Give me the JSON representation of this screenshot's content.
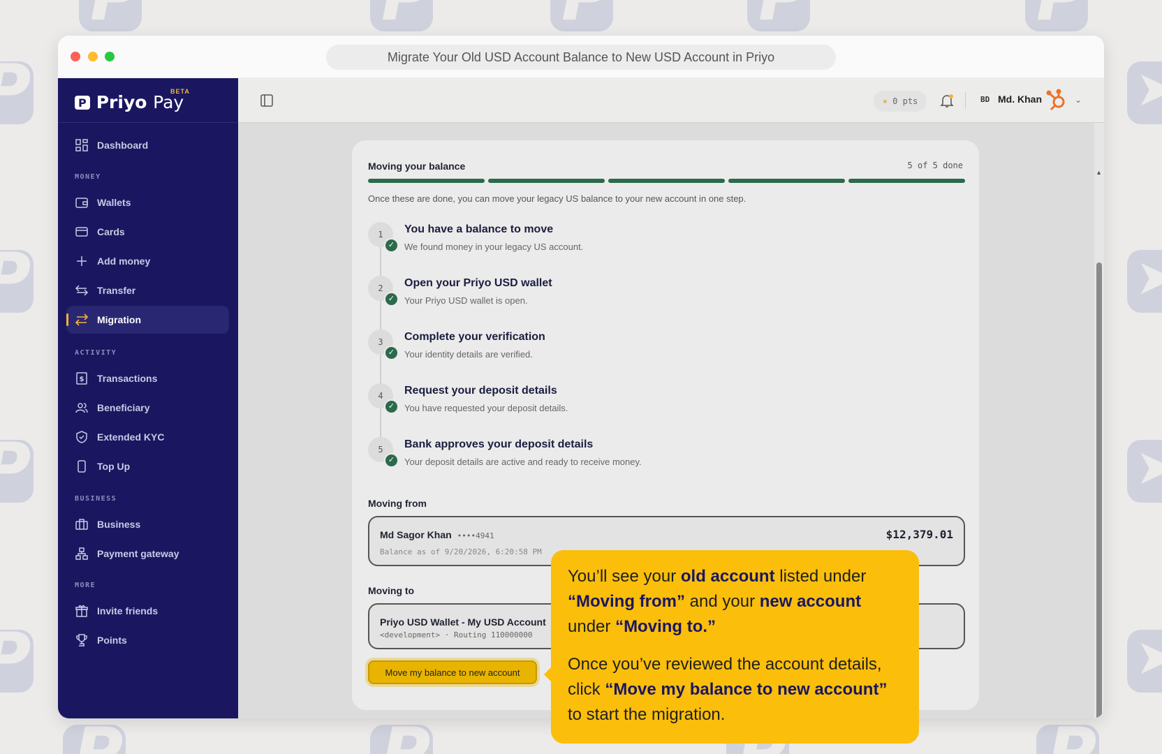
{
  "browser": {
    "url_title": "Migrate Your Old USD Account Balance to New USD Account in Priyo"
  },
  "sidebar": {
    "brand": "Priyo",
    "brand_suffix": "Pay",
    "badge": "BETA",
    "sections": {
      "money": "MONEY",
      "activity": "ACTIVITY",
      "business": "BUSINESS",
      "more": "MORE"
    },
    "items": [
      {
        "label": "Dashboard",
        "icon": "grid-icon"
      },
      {
        "label": "Wallets",
        "icon": "wallet-icon"
      },
      {
        "label": "Cards",
        "icon": "card-icon"
      },
      {
        "label": "Add money",
        "icon": "plus-icon"
      },
      {
        "label": "Transfer",
        "icon": "transfer-icon"
      },
      {
        "label": "Migration",
        "icon": "migration-icon",
        "active": true
      },
      {
        "label": "Transactions",
        "icon": "dollar-doc-icon"
      },
      {
        "label": "Beneficiary",
        "icon": "users-icon"
      },
      {
        "label": "Extended KYC",
        "icon": "shield-check-icon"
      },
      {
        "label": "Top Up",
        "icon": "phone-icon"
      },
      {
        "label": "Business",
        "icon": "briefcase-icon"
      },
      {
        "label": "Payment gateway",
        "icon": "network-icon"
      },
      {
        "label": "Invite friends",
        "icon": "gift-icon"
      },
      {
        "label": "Points",
        "icon": "trophy-icon"
      }
    ]
  },
  "topbar": {
    "points": "0 pts",
    "country": "BD",
    "user": "Md. Khan"
  },
  "card": {
    "title": "Moving your balance",
    "progress_text": "5 of 5 done",
    "progress": {
      "done": 5,
      "total": 5
    },
    "intro": "Once these are done, you can move your legacy US balance to your new account in one step.",
    "steps": [
      {
        "num": "1",
        "title": "You have a balance to move",
        "desc": "We found money in your legacy US account."
      },
      {
        "num": "2",
        "title": "Open your Priyo USD wallet",
        "desc": "Your Priyo USD wallet is open."
      },
      {
        "num": "3",
        "title": "Complete your verification",
        "desc": "Your identity details are verified."
      },
      {
        "num": "4",
        "title": "Request your deposit details",
        "desc": "You have requested your deposit details."
      },
      {
        "num": "5",
        "title": "Bank approves your deposit details",
        "desc": "Your deposit details are active and ready to receive money."
      }
    ],
    "from": {
      "label": "Moving from",
      "name": "Md Sagor Khan",
      "mask": "••••4941",
      "sub": "Balance as of 9/20/2026, 6:20:58 PM",
      "amount": "$12,379.01"
    },
    "to": {
      "label": "Moving to",
      "name": "Priyo USD Wallet - My USD Account",
      "sub": "<development> · Routing 110000000"
    },
    "button": "Move my balance to new account"
  },
  "callout": {
    "p1": [
      "You’ll see your ",
      "old account",
      " listed under ",
      "“Moving from”",
      " and your ",
      "new account",
      " under ",
      "“Moving to.”"
    ],
    "p2": [
      "Once you’ve reviewed the account details, click ",
      "“Move my balance to new account”",
      " to start the migration."
    ]
  },
  "colors": {
    "sidebar": "#1a1760",
    "accent": "#f4b43a",
    "progress": "#2b6a4b",
    "callout": "#fbbe0b"
  }
}
